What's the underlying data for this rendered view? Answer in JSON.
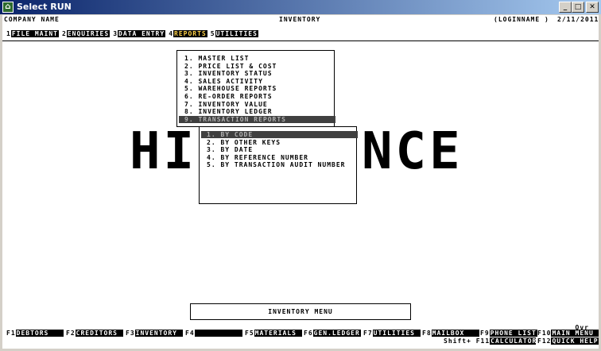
{
  "window": {
    "title": "Select RUN",
    "app_icon": "app-logo-icon",
    "controls": [
      "minimize-icon",
      "maximize-icon",
      "close-icon"
    ]
  },
  "header": {
    "company": "COMPANY NAME",
    "module": "INVENTORY",
    "login": "(LOGINNAME )",
    "date": "2/11/2011"
  },
  "menubar": [
    {
      "num": "1",
      "label": "FILE MAINT"
    },
    {
      "num": "2",
      "label": "ENQUIRIES"
    },
    {
      "num": "3",
      "label": "DATA ENTRY"
    },
    {
      "num": "4",
      "label": "REPORTS"
    },
    {
      "num": "5",
      "label": "UTILITIES"
    }
  ],
  "background_text": {
    "left": "HI",
    "right": "NCE"
  },
  "reports_menu": {
    "items": [
      "1. MASTER LIST",
      "2. PRICE LIST & COST",
      "3. INVENTORY STATUS",
      "4. SALES ACTIVITY",
      "5. WAREHOUSE REPORTS",
      "6. RE-ORDER REPORTS",
      "7. INVENTORY VALUE",
      "8. INVENTORY LEDGER",
      "9. TRANSACTION REPORTS"
    ],
    "selected_index": 8
  },
  "transaction_submenu": {
    "items": [
      "1. BY CODE",
      "2. BY OTHER KEYS",
      "3. BY DATE",
      "4. BY REFERENCE NUMBER",
      "5. BY TRANSACTION AUDIT NUMBER"
    ],
    "selected_index": 0
  },
  "status": {
    "menu_label": "INVENTORY MENU",
    "ovr": "Ovr"
  },
  "fkeys": {
    "f1": "F1",
    "f1_label": "DEBTORS",
    "f2": "F2",
    "f2_label": "CREDITORS",
    "f3": "F3",
    "f3_label": "INVENTORY",
    "f4": "F4",
    "f4_label": "",
    "f5": "F5",
    "f5_label": "MATERIALS",
    "f6": "F6",
    "f6_label": "GEN.LEDGER",
    "f7": "F7",
    "f7_label": "UTILITIES",
    "f8": "F8",
    "f8_label": "MAILBOX",
    "f9": "F9",
    "f9_label": "PHONE LIST",
    "f10": "F10",
    "f10_label": "MAIN MENU",
    "f11": "Shift+ F11",
    "f11_label": "CALCULATOR",
    "f12": "F12",
    "f12_label": "QUICK HELP"
  }
}
